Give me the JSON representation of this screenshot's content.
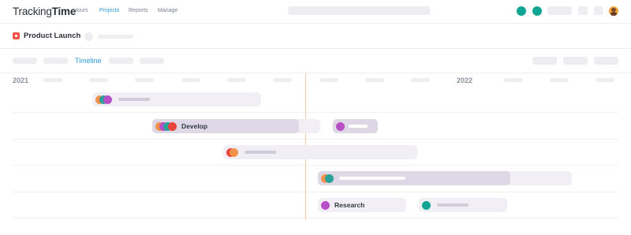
{
  "app": {
    "logo_regular": "Tracking",
    "logo_bold": "Time"
  },
  "nav": {
    "items": [
      {
        "label": "Hours",
        "active": false
      },
      {
        "label": "Projects",
        "active": true
      },
      {
        "label": "Reports",
        "active": false
      },
      {
        "label": "Manage",
        "active": false
      }
    ]
  },
  "project": {
    "title": "Product Launch",
    "icon": "star-icon",
    "icon_color": "#f0564b"
  },
  "view_tabs": {
    "active_label": "Timeline"
  },
  "timeline": {
    "years": [
      "2021",
      "2022"
    ],
    "today_marker_color": "#f2c9a4",
    "tasks": [
      {
        "label": "",
        "avatars": [
          "#f0924a",
          "#2aa198",
          "#b94fc6"
        ]
      },
      {
        "label": "Develop",
        "avatars": [
          "#f0924a",
          "#b94fc6",
          "#2aa198",
          "#e8453c"
        ]
      },
      {
        "label": "",
        "avatars": [
          "#b94fc6"
        ]
      },
      {
        "label": "",
        "avatars": [
          "#e8453c",
          "#f0924a"
        ]
      },
      {
        "label": "",
        "avatars": [
          "#f0924a",
          "#2aa198"
        ]
      },
      {
        "label": "Research",
        "avatars": [
          "#b94fc6"
        ]
      },
      {
        "label": "",
        "avatars": [
          "#12a594"
        ]
      }
    ]
  },
  "colors": {
    "accent_blue": "#2b9ad6",
    "teal": "#12a594",
    "purple": "#b94fc6",
    "red": "#e8453c",
    "orange": "#f0924a"
  }
}
